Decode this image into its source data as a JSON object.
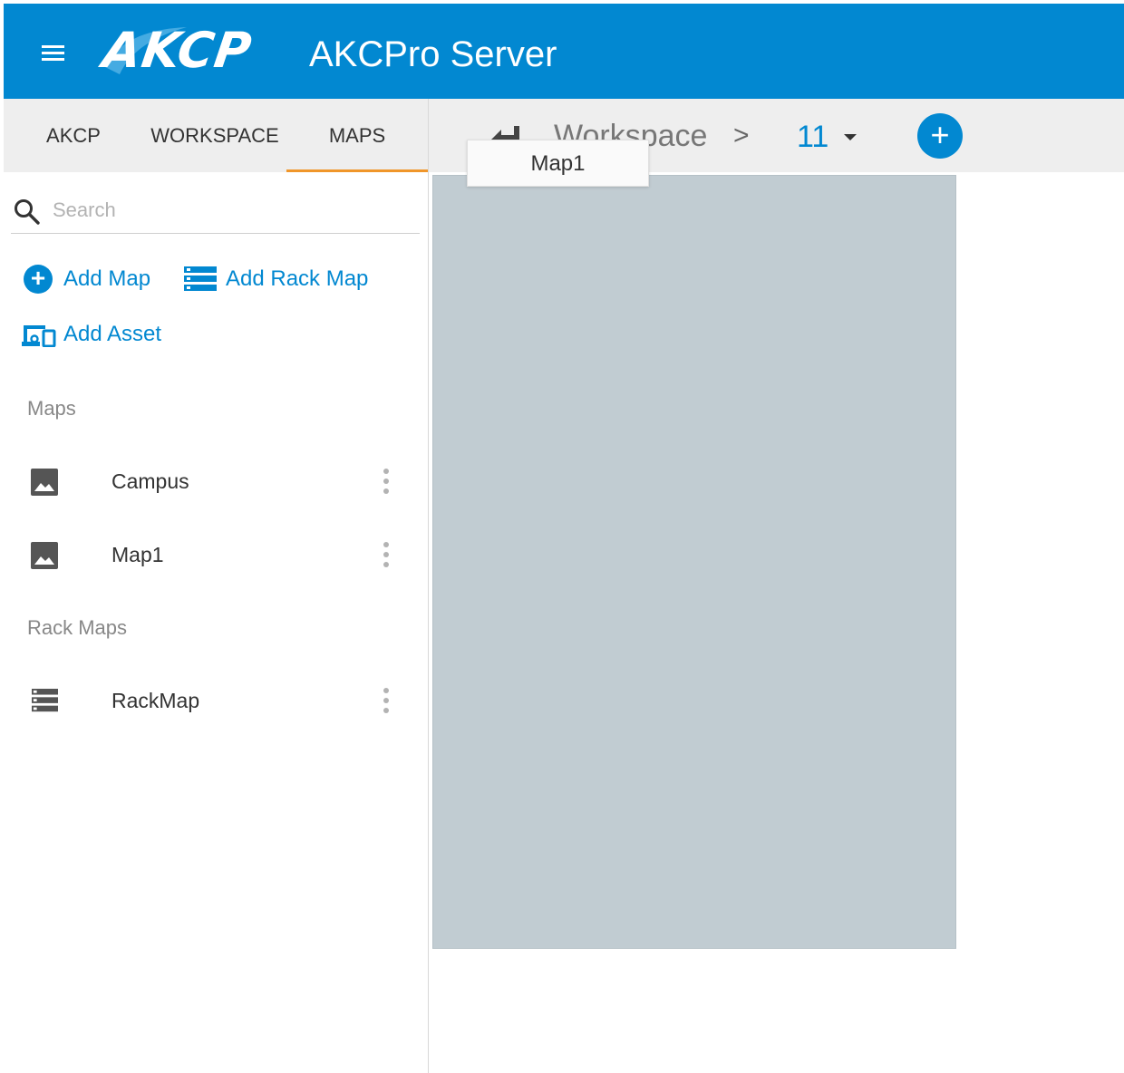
{
  "header": {
    "logo_text": "AKCP",
    "app_title": "AKCPro Server",
    "menu_icon": "hamburger-menu-icon",
    "colors": {
      "primary": "#0288d1",
      "accent": "#f0962a",
      "canvas": "#c1ccd2"
    }
  },
  "tabs": [
    {
      "label": "AKCP",
      "active": false
    },
    {
      "label": "WORKSPACE",
      "active": false
    },
    {
      "label": "MAPS",
      "active": true
    }
  ],
  "toolbar": {
    "back_icon": "back-arrow-icon",
    "breadcrumb": "Workspace",
    "separator": ">",
    "current": "11",
    "add_icon": "plus-icon",
    "add_label": "+"
  },
  "tooltip": {
    "text": "Map1"
  },
  "search": {
    "placeholder": "Search",
    "value": "",
    "icon": "search-icon"
  },
  "actions": {
    "add_map": "Add Map",
    "add_rack_map": "Add Rack Map",
    "add_asset": "Add Asset"
  },
  "sections": {
    "maps": {
      "title": "Maps",
      "items": [
        {
          "label": "Campus",
          "icon": "image-icon"
        },
        {
          "label": "Map1",
          "icon": "image-icon"
        }
      ]
    },
    "rack_maps": {
      "title": "Rack Maps",
      "items": [
        {
          "label": "RackMap",
          "icon": "rack-icon"
        }
      ]
    }
  }
}
